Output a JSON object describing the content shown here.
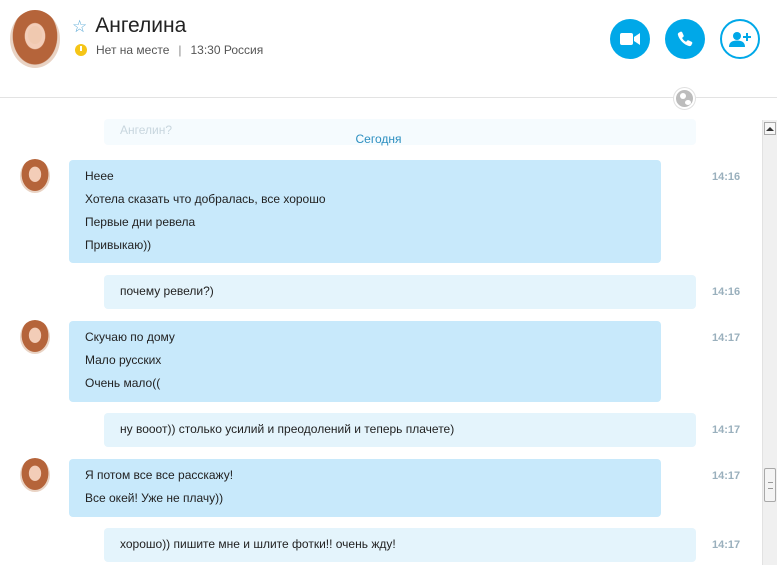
{
  "header": {
    "contact_name": "Ангелина",
    "status": "Нет на месте",
    "separator": "|",
    "local_time": "13:30 Россия",
    "favorite_icon": "star-outline-icon",
    "status_icon": "clock-icon",
    "buttons": {
      "video_call": "video-call-icon",
      "audio_call": "phone-icon",
      "add_person": "add-person-icon"
    }
  },
  "chat": {
    "ghost_text": "Ангелин?",
    "date_divider": "Сегодня",
    "messages": [
      {
        "direction": "in",
        "time": "14:16",
        "lines": [
          "Неее",
          "Хотела сказать что добралась, все хорошо",
          "Первые дни ревела",
          "Привыкаю))"
        ]
      },
      {
        "direction": "out",
        "time": "14:16",
        "lines": [
          "почему ревели?)"
        ]
      },
      {
        "direction": "in",
        "time": "14:17",
        "lines": [
          "Скучаю по дому",
          "Мало русских",
          "Очень мало(("
        ]
      },
      {
        "direction": "out",
        "time": "14:17",
        "lines": [
          "ну вооот)) столько усилий и преодолений и теперь плачете)"
        ]
      },
      {
        "direction": "in",
        "time": "14:17",
        "lines": [
          "Я потом все все расскажу!",
          "Все окей! Уже не плачу))"
        ]
      },
      {
        "direction": "out",
        "time": "14:17",
        "lines": [
          "хорошо)) пишите мне и шлите фотки!! очень жду!"
        ]
      }
    ]
  },
  "colors": {
    "accent": "#00a8e8",
    "incoming_bubble": "#c8e9fb",
    "outgoing_bubble": "#e4f4fc",
    "date_text": "#2c8fc0",
    "timestamp": "#9ab0bd",
    "status_away": "#f5c517"
  }
}
